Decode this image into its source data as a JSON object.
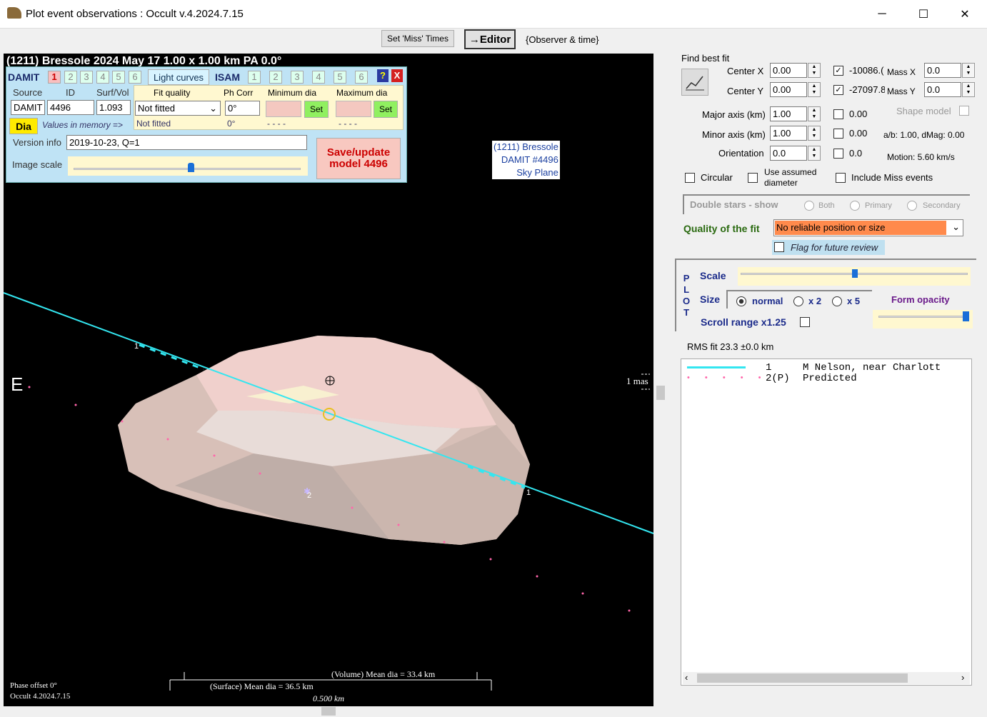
{
  "window": {
    "title": "Plot event observations : Occult v.4.2024.7.15",
    "min": "─",
    "max": "☐",
    "close": "✕"
  },
  "toolbar": {
    "set_miss": "Set 'Miss' Times",
    "editor": "→Editor",
    "observer": "{Observer & time}"
  },
  "plot": {
    "header": "(1211) Bressole  2024 May 17   1.00 x 1.00 km  PA 0.0°",
    "label_box": [
      "(1211) Bressole",
      "DAMIT #4496",
      "Sky Plane"
    ],
    "east": "E",
    "mas": "1 mas",
    "chord_label_1": "1",
    "chord_label_2": "1",
    "chord_label_pred": "2",
    "volume_dia": "(Volume) Mean dia = 33.4 km",
    "surface_dia": "(Surface) Mean dia = 36.5 km",
    "scale_bar": "0.500 km",
    "phase_offset": "Phase offset 0°",
    "version": "Occult 4.2024.7.15"
  },
  "model_panel": {
    "damit": "DAMIT",
    "damit_tabs": [
      "1",
      "2",
      "3",
      "4",
      "5",
      "6"
    ],
    "light_curves": "Light curves",
    "isam": "ISAM",
    "isam_tabs": [
      "1",
      "2",
      "3",
      "4",
      "5",
      "6"
    ],
    "help": "?",
    "close": "X",
    "source_lbl": "Source",
    "id_lbl": "ID",
    "surfvol_lbl": "Surf/Vol",
    "source": "DAMIT",
    "id": "4496",
    "surfvol": "1.093",
    "fit_quality_lbl": "Fit quality",
    "ph_corr_lbl": "Ph Corr",
    "min_dia_lbl": "Minimum dia",
    "max_dia_lbl": "Maximum dia",
    "fit_quality": "Not fitted",
    "ph_corr": "0°",
    "set": "Set",
    "dia": "Dia",
    "values_in_memory": "Values in memory =>",
    "mem_fit": "Not fitted",
    "mem_ph": "0°",
    "mem_min": "- - - -",
    "mem_max": "- - - -",
    "version_lbl": "Version info",
    "version": "2019-10-23, Q=1",
    "image_scale_lbl": "Image scale",
    "save": "Save/update model 4496"
  },
  "right": {
    "find_best_fit": "Find best fit",
    "center_x_lbl": "Center X",
    "center_x": "0.00",
    "center_y_lbl": "Center Y",
    "center_y": "0.00",
    "cx_val": "-10086.(",
    "cy_val": "-27097.8",
    "mass_x_lbl": "Mass X",
    "mass_x": "0.0",
    "mass_y_lbl": "Mass Y",
    "mass_y": "0.0",
    "major_lbl": "Major axis (km)",
    "major": "1.00",
    "major_chk": "0.00",
    "minor_lbl": "Minor axis (km)",
    "minor": "1.00",
    "minor_chk": "0.00",
    "orient_lbl": "Orientation",
    "orient": "0.0",
    "orient_chk": "0.0",
    "shape_model": "Shape model",
    "ab": "a/b: 1.00, dMag: 0.00",
    "motion": "Motion: 5.60 km/s",
    "circular": "Circular",
    "use_assumed": "Use assumed diameter",
    "include_miss": "Include Miss events",
    "double_stars": "Double stars - show",
    "both": "Both",
    "primary": "Primary",
    "secondary": "Secondary",
    "quality_lbl": "Quality of the fit",
    "quality": "No reliable position or size",
    "flag": "Flag for future review",
    "plot_letters": [
      "P",
      "L",
      "O",
      "T"
    ],
    "scale": "Scale",
    "size": "Size",
    "normal": "normal",
    "x2": "x 2",
    "x5": "x 5",
    "form_opacity": "Form opacity",
    "scroll_range": "Scroll range x1.25",
    "rms": "RMS fit 23.3 ±0.0 km",
    "legend": [
      {
        "num": "1",
        "name": "M Nelson, near Charlott"
      },
      {
        "num": "2(P)",
        "name": "Predicted"
      }
    ]
  },
  "colors": {
    "chord": "#33e6f0",
    "predicted": "#ff66aa",
    "asteroid": "#e6cfc8",
    "quality_bg": "#ff8a4c"
  }
}
